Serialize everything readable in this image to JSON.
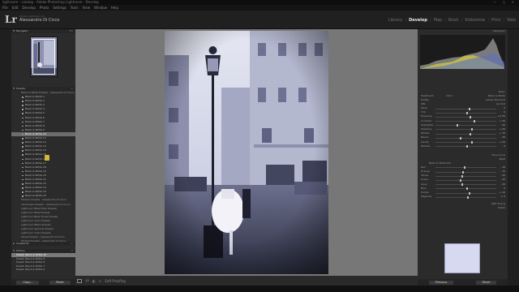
{
  "window": {
    "title": "lightroom - catalog - Adobe Photoshop Lightroom - Develop",
    "controls": "— ▢ ✕"
  },
  "menu": [
    "File",
    "Edit",
    "Develop",
    "Photo",
    "Settings",
    "Tools",
    "View",
    "Window",
    "Help"
  ],
  "identity": {
    "logo": "Lr",
    "line1": "Adobe Lightroom CC",
    "line2": "Alessandro Di Cicco"
  },
  "modules": {
    "items": [
      "Library",
      "Develop",
      "Map",
      "Book",
      "Slideshow",
      "Print",
      "Web"
    ],
    "active": "Develop"
  },
  "left_panel": {
    "navigator": {
      "label": "Navigator",
      "zoom": "FIT"
    },
    "presets": {
      "label": "Presets",
      "items": [
        "Black & White Presets - Alessandro Di Cicco",
        "Black & White 1",
        "Black & White 2",
        "Black & White 3",
        "Black & White 4",
        "Black & White 5",
        "Black & White 6",
        "Black & White 7",
        "Black & White 8",
        "Black & White 9",
        "Black & White 10",
        "Black & White 11",
        "Black & White 12",
        "Black & White 13",
        "Black & White 14",
        "Black & White 15",
        "Black & White 16",
        "Black & White 17",
        "Black & White 18",
        "Black & White 19",
        "Black & White 20",
        "Black & White 21",
        "Black & White 22",
        "Black & White 23",
        "Black & White 24",
        "Black & White 25",
        "Fashion Presets - Alessandro Di Cicco",
        "Landscape Presets - Alessandro Di Cicco",
        "Lightroom B&W Filter Presets",
        "Lightroom B&W Presets",
        "Lightroom B&W Toned Presets",
        "Lightroom Color Presets",
        "Lightroom Effect Presets",
        "Lightroom General Presets",
        "Lightroom Video Presets",
        "Street Presets - Alessandro Di Cicco",
        "Portrait Presets - Alessandro Di Cicco",
        "Travel Presets - Alessandro Di Cicco",
        "User Presets"
      ],
      "selected_index": 10
    },
    "snapshots_label": "Snapshots",
    "history": {
      "label": "History",
      "items": [
        "Preset: Black & White 10",
        "Preset: Black & White 9",
        "Preset: Black & White 8",
        "Preset: Black & White 7",
        "Preset: Black & White 6"
      ]
    },
    "copy_button": "Copy...",
    "paste_button": "Paste"
  },
  "toolbar": {
    "soft_proofing": "Soft Proofing"
  },
  "right_panel": {
    "histogram_label": "Histogram",
    "basic_label": "Basic",
    "treatment": "Treatment:",
    "color_label": "Color",
    "bw_label": "Black & White",
    "profile_label": "Profile:",
    "profile_value": "Adobe Standard",
    "wb_label": "WB:",
    "wb_value": "As Shot",
    "sliders": [
      {
        "label": "Temp",
        "value": "0",
        "pos": 0.55
      },
      {
        "label": "Tint",
        "value": "0",
        "pos": 0.5
      },
      {
        "label": "Exposure",
        "value": "+ 0.35",
        "pos": 0.56
      },
      {
        "label": "Contrast",
        "value": "+ 25",
        "pos": 0.62
      },
      {
        "label": "Highlights",
        "value": "- 40",
        "pos": 0.35
      },
      {
        "label": "Shadows",
        "value": "+ 20",
        "pos": 0.58
      },
      {
        "label": "Whites",
        "value": "+ 15",
        "pos": 0.56
      },
      {
        "label": "Blacks",
        "value": "- 30",
        "pos": 0.4
      },
      {
        "label": "Clarity",
        "value": "+ 20",
        "pos": 0.59
      },
      {
        "label": "Dehaze",
        "value": "0",
        "pos": 0.5
      }
    ],
    "tone_curve_label": "Tone Curve",
    "bw_mix_label": "B&W",
    "bw_mix_sub": "Black & White Mix",
    "mix": [
      {
        "label": "Red",
        "value": "- 10",
        "pos": 0.46
      },
      {
        "label": "Orange",
        "value": "- 15",
        "pos": 0.44
      },
      {
        "label": "Yellow",
        "value": "- 20",
        "pos": 0.42
      },
      {
        "label": "Green",
        "value": "- 25",
        "pos": 0.4
      },
      {
        "label": "Aqua",
        "value": "- 20",
        "pos": 0.42
      },
      {
        "label": "Blue",
        "value": "0",
        "pos": 0.5
      },
      {
        "label": "Purple",
        "value": "+ 10",
        "pos": 0.54
      },
      {
        "label": "Magenta",
        "value": "+ 5",
        "pos": 0.52
      }
    ],
    "split_toning_label": "Split Toning",
    "detail_label": "Detail",
    "previous_button": "Previous",
    "reset_button": "Reset"
  }
}
